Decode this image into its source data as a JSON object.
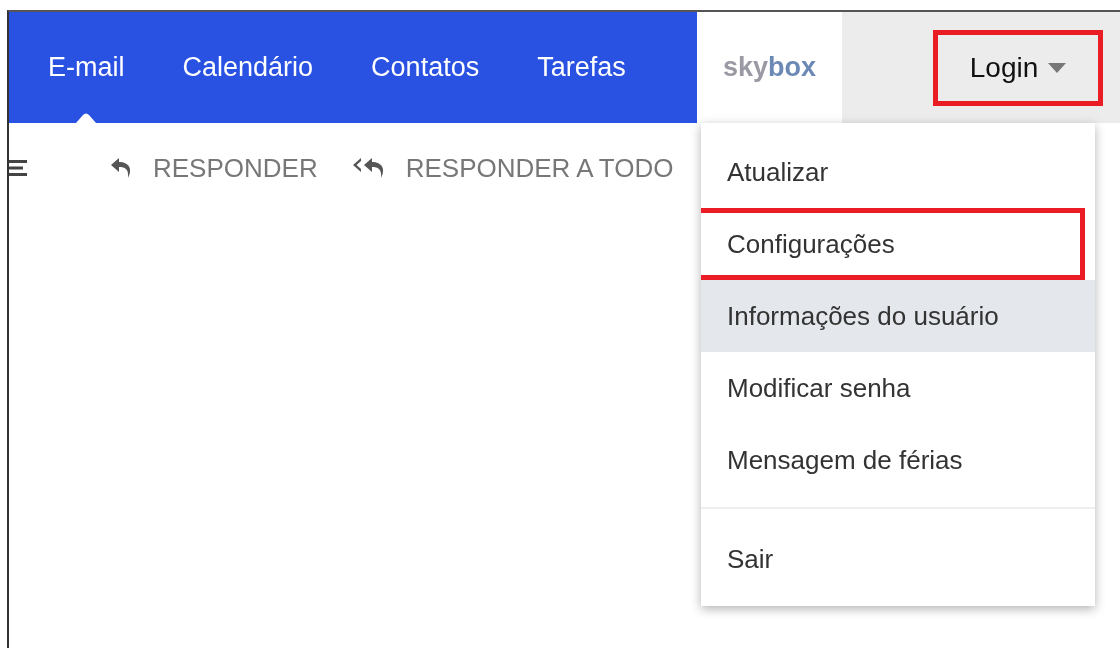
{
  "nav": {
    "tabs": [
      {
        "label": "E-mail",
        "selected": true
      },
      {
        "label": "Calendário",
        "selected": false
      },
      {
        "label": "Contatos",
        "selected": false
      },
      {
        "label": "Tarefas",
        "selected": false
      }
    ],
    "brand": {
      "parts": [
        "sky",
        "box"
      ]
    },
    "login": {
      "label": "Login",
      "highlighted": true
    }
  },
  "toolbar": {
    "actions": [
      {
        "kind": "reply",
        "label": "RESPONDER"
      },
      {
        "kind": "reply-all",
        "label": "RESPONDER A TODO"
      }
    ]
  },
  "menu": {
    "items": [
      {
        "label": "Atualizar",
        "highlighted": false,
        "hovered": false
      },
      {
        "label": "Configurações",
        "highlighted": true,
        "hovered": false
      },
      {
        "label": "Informações do usuário",
        "highlighted": false,
        "hovered": true
      },
      {
        "label": "Modificar senha",
        "highlighted": false,
        "hovered": false
      },
      {
        "label": "Mensagem de férias",
        "highlighted": false,
        "hovered": false
      }
    ],
    "footer_items": [
      {
        "label": "Sair",
        "highlighted": false,
        "hovered": false
      }
    ]
  }
}
